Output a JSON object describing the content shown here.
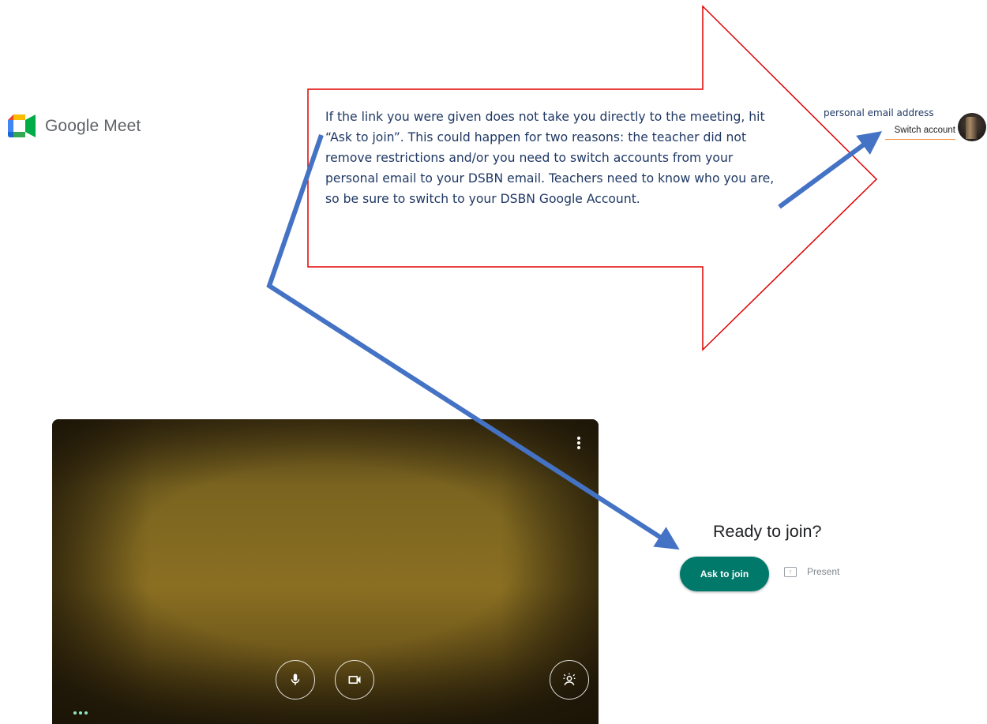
{
  "app": {
    "name": "Google Meet"
  },
  "annotation": {
    "text": "If the link you were given does not take you directly to the meeting, hit “Ask to join”.  This could happen for two reasons: the teacher did not remove restrictions and/or you need to switch accounts from your personal email to your DSBN email. Teachers need to know who you are, so be sure to switch to your DSBN Google Account.",
    "border_color": "#e00000",
    "pointer_color": "#4472c4"
  },
  "account": {
    "email_label": "personal email address",
    "switch_label": "Switch account"
  },
  "preview": {
    "controls": {
      "mic_icon": "microphone-icon",
      "camera_icon": "videocam-icon",
      "effects_icon": "background-effects-icon",
      "more_icon": "more-vert-icon"
    }
  },
  "join": {
    "title": "Ready to join?",
    "ask_label": "Ask to join",
    "present_label": "Present",
    "accent_color": "#00796b"
  }
}
